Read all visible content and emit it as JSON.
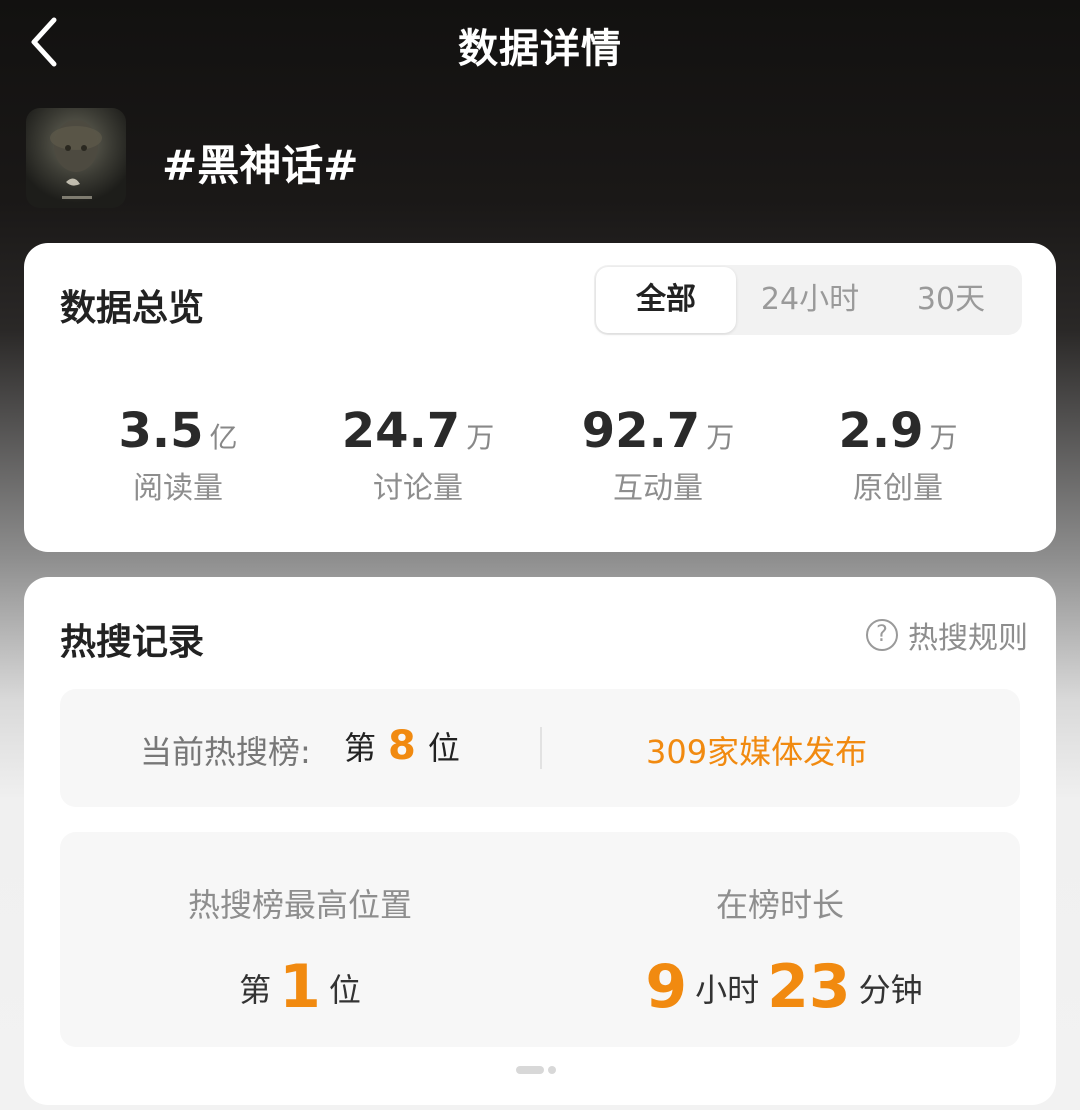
{
  "header": {
    "title": "数据详情",
    "back_icon": "chevron-left-icon"
  },
  "topic": {
    "title": "#黑神话#"
  },
  "overview": {
    "title": "数据总览",
    "tabs": [
      {
        "label": "全部",
        "active": true
      },
      {
        "label": "24小时",
        "active": false
      },
      {
        "label": "30天",
        "active": false
      }
    ],
    "stats": [
      {
        "value": "3.5",
        "unit": "亿",
        "label": "阅读量"
      },
      {
        "value": "24.7",
        "unit": "万",
        "label": "讨论量"
      },
      {
        "value": "92.7",
        "unit": "万",
        "label": "互动量"
      },
      {
        "value": "2.9",
        "unit": "万",
        "label": "原创量"
      }
    ]
  },
  "hot_search": {
    "title": "热搜记录",
    "rules_label": "热搜规则",
    "rules_icon": "help-circle-icon",
    "current": {
      "label": "当前热搜榜:",
      "rank_prefix": "第",
      "rank": "8",
      "rank_suffix": "位",
      "media": "309家媒体发布"
    },
    "highest": {
      "label": "热搜榜最高位置",
      "prefix": "第",
      "value": "1",
      "suffix": "位"
    },
    "duration": {
      "label": "在榜时长",
      "hours": "9",
      "hours_unit": "小时",
      "minutes": "23",
      "minutes_unit": "分钟"
    }
  },
  "colors": {
    "accent": "#f18a10",
    "header_bg": "#121110"
  }
}
